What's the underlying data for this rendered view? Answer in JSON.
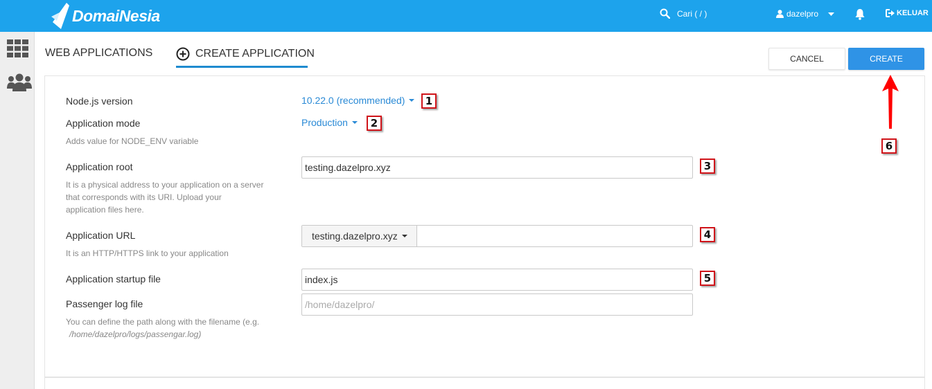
{
  "header": {
    "logo_text": "DomaiNesia",
    "search_label": "Cari ( / )",
    "username": "dazelpro",
    "logout_label": "KELUAR"
  },
  "tabs": {
    "web_applications": "WEB APPLICATIONS",
    "create_application": "CREATE APPLICATION"
  },
  "actions": {
    "cancel_label": "CANCEL",
    "create_label": "CREATE"
  },
  "form": {
    "nodejs_version": {
      "label": "Node.js version",
      "value": "10.22.0 (recommended)"
    },
    "app_mode": {
      "label": "Application mode",
      "value": "Production",
      "help": "Adds value for NODE_ENV variable"
    },
    "app_root": {
      "label": "Application root",
      "value": "testing.dazelpro.xyz",
      "help_lines": [
        "It is a physical address to your application on a server",
        "that corresponds with its URI. Upload your",
        "application files here."
      ]
    },
    "app_url": {
      "label": "Application URL",
      "domain": "testing.dazelpro.xyz",
      "path": "",
      "help": "It is an HTTP/HTTPS link to your application"
    },
    "startup_file": {
      "label": "Application startup file",
      "value": "index.js"
    },
    "passenger_log": {
      "label": "Passenger log file",
      "placeholder": "/home/dazelpro/",
      "help_line1": "You can define the path along with the filename (e.g.",
      "help_path": "/home/dazelpro/logs/passengar.log)"
    }
  },
  "annotations": [
    "1",
    "2",
    "3",
    "4",
    "5",
    "6"
  ],
  "colors": {
    "topbar": "#1da3ec",
    "create_button": "#2f93e6",
    "link": "#2a8ad6",
    "annotation_border": "#d0141a",
    "arrow": "#ff0000"
  }
}
